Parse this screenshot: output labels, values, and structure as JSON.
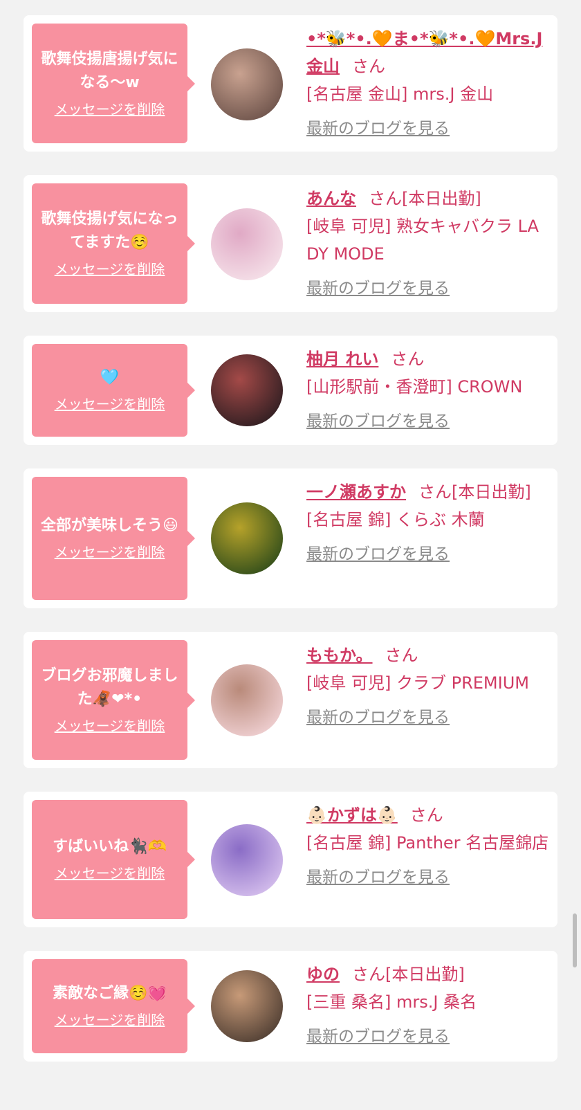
{
  "cards": [
    {
      "message": "歌舞伎揚唐揚げ気になる〜w",
      "delete_label": "メッセージを削除",
      "name": "•*🐝*•.🧡ま•*🐝*•.🧡Mrs.J金山",
      "san": "さん",
      "badge": "",
      "shop": "[名古屋 金山] mrs.J 金山",
      "blog_label": "最新のブログを見る",
      "avatar_colors": [
        "#6a5048",
        "#c9a290"
      ]
    },
    {
      "message": "歌舞伎揚げ気になってますた☺️",
      "delete_label": "メッセージを削除",
      "name": "あんな",
      "san": "さん",
      "badge": "[本日出勤]",
      "shop": "[岐阜 可児] 熟女キャバクラ LADY MODE",
      "blog_label": "最新のブログを見る",
      "avatar_colors": [
        "#f6e3ea",
        "#e0a9c5"
      ]
    },
    {
      "message": "🩵",
      "delete_label": "メッセージを削除",
      "name": "柚月 れい",
      "san": "さん",
      "badge": "",
      "shop": "[山形駅前・香澄町] CROWN",
      "blog_label": "最新のブログを見る",
      "avatar_colors": [
        "#2a1c20",
        "#a44a48"
      ]
    },
    {
      "message": "全部が美味しそう😃",
      "delete_label": "メッセージを削除",
      "name": "一ノ瀬あすか",
      "san": "さん",
      "badge": "[本日出勤]",
      "shop": "[名古屋 錦] くらぶ 木蘭",
      "blog_label": "最新のブログを見る",
      "avatar_colors": [
        "#2b4a1a",
        "#b6a22a"
      ]
    },
    {
      "message": "ブログお邪魔しました🦧❤︎*•",
      "delete_label": "メッセージを削除",
      "name": "ももか。",
      "san": "さん",
      "badge": "",
      "shop": "[岐阜 可児] クラブ PREMIUM",
      "blog_label": "最新のブログを見る",
      "avatar_colors": [
        "#f2d3d6",
        "#b98a7a"
      ]
    },
    {
      "message": "すばいいね🐈‍⬛🫶",
      "delete_label": "メッセージを削除",
      "name": "👶🏻かずは👶🏻",
      "san": "さん",
      "badge": "",
      "shop": "[名古屋 錦] Panther 名古屋錦店",
      "blog_label": "最新のブログを見る",
      "avatar_colors": [
        "#d8c2ee",
        "#8a6cc6"
      ]
    },
    {
      "message": "素敵なご縁☺️💓",
      "delete_label": "メッセージを削除",
      "name": "ゆの",
      "san": "さん",
      "badge": "[本日出勤]",
      "shop": "[三重 桑名] mrs.J 桑名",
      "blog_label": "最新のブログを見る",
      "avatar_colors": [
        "#4a3a30",
        "#c79a78"
      ]
    }
  ]
}
